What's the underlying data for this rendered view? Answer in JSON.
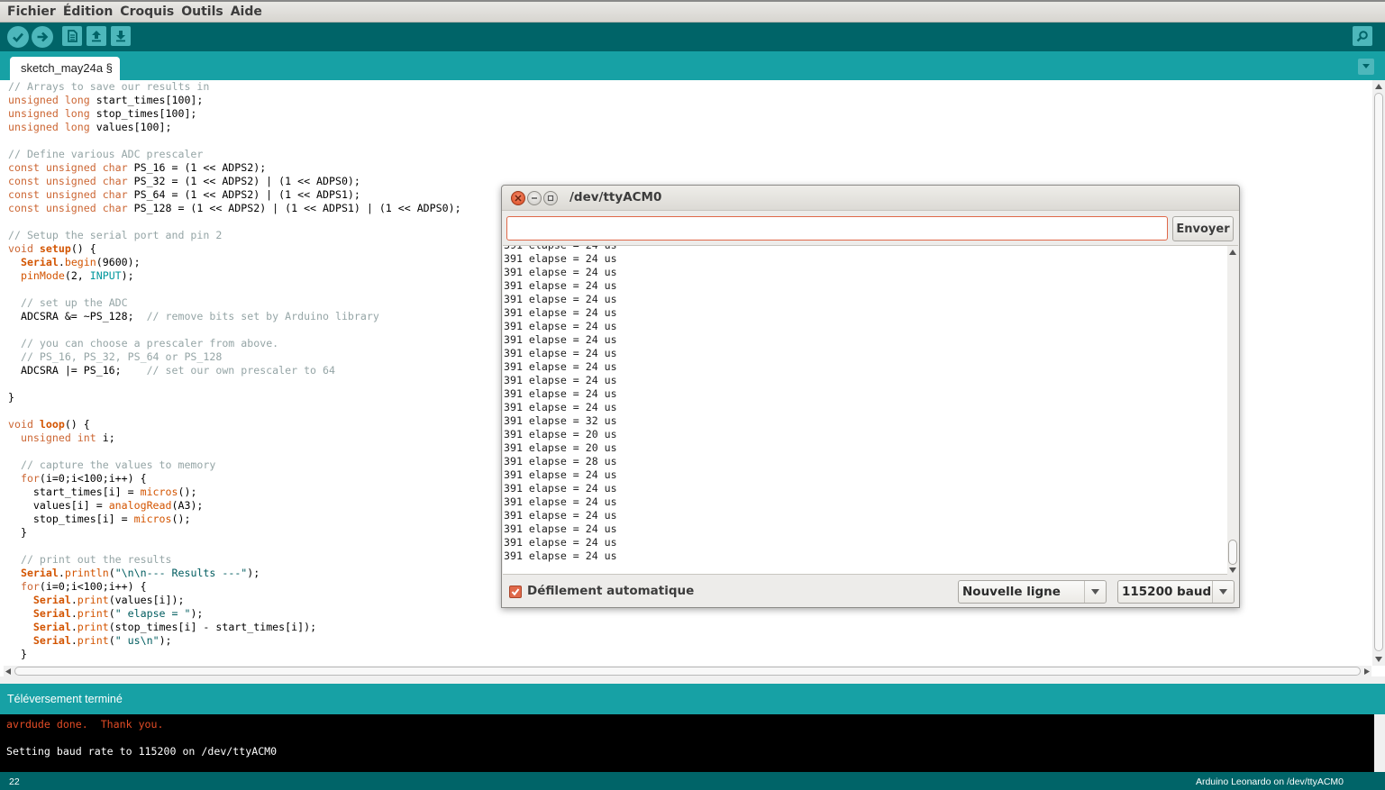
{
  "menubar": {
    "items": [
      "Fichier",
      "Édition",
      "Croquis",
      "Outils",
      "Aide"
    ]
  },
  "toolbar": {
    "buttons": [
      "verify-icon",
      "upload-icon",
      "new-icon",
      "open-icon",
      "save-icon"
    ],
    "serial_monitor_icon": "magnifier-icon"
  },
  "tabs": {
    "active": "sketch_may24a §"
  },
  "editor": {
    "lines": [
      [
        [
          "c",
          "// Arrays to save our results in"
        ]
      ],
      [
        [
          "k",
          "unsigned long"
        ],
        [
          "p",
          " start_times[100];"
        ]
      ],
      [
        [
          "k",
          "unsigned long"
        ],
        [
          "p",
          " stop_times[100];"
        ]
      ],
      [
        [
          "k",
          "unsigned long"
        ],
        [
          "p",
          " values[100];"
        ]
      ],
      [
        [
          "p",
          ""
        ]
      ],
      [
        [
          "c",
          "// Define various ADC prescaler"
        ]
      ],
      [
        [
          "k",
          "const unsigned char"
        ],
        [
          "p",
          " PS_16 = (1 << ADPS2);"
        ]
      ],
      [
        [
          "k",
          "const unsigned char"
        ],
        [
          "p",
          " PS_32 = (1 << ADPS2) | (1 << ADPS0);"
        ]
      ],
      [
        [
          "k",
          "const unsigned char"
        ],
        [
          "p",
          " PS_64 = (1 << ADPS2) | (1 << ADPS1);"
        ]
      ],
      [
        [
          "k",
          "const unsigned char"
        ],
        [
          "p",
          " PS_128 = (1 << ADPS2) | (1 << ADPS1) | (1 << ADPS0);"
        ]
      ],
      [
        [
          "p",
          ""
        ]
      ],
      [
        [
          "c",
          "// Setup the serial port and pin 2"
        ]
      ],
      [
        [
          "k",
          "void"
        ],
        [
          "p",
          " "
        ],
        [
          "fb",
          "setup"
        ],
        [
          "p",
          "() {"
        ]
      ],
      [
        [
          "p",
          "  "
        ],
        [
          "fb",
          "Serial"
        ],
        [
          "p",
          "."
        ],
        [
          "f",
          "begin"
        ],
        [
          "p",
          "(9600);"
        ]
      ],
      [
        [
          "p",
          "  "
        ],
        [
          "f",
          "pinMode"
        ],
        [
          "p",
          "(2, "
        ],
        [
          "n",
          "INPUT"
        ],
        [
          "p",
          ");"
        ]
      ],
      [
        [
          "p",
          ""
        ]
      ],
      [
        [
          "p",
          "  "
        ],
        [
          "c",
          "// set up the ADC"
        ]
      ],
      [
        [
          "p",
          "  ADCSRA &= ~PS_128;  "
        ],
        [
          "c",
          "// remove bits set by Arduino library"
        ]
      ],
      [
        [
          "p",
          ""
        ]
      ],
      [
        [
          "p",
          "  "
        ],
        [
          "c",
          "// you can choose a prescaler from above."
        ]
      ],
      [
        [
          "p",
          "  "
        ],
        [
          "c",
          "// PS_16, PS_32, PS_64 or PS_128"
        ]
      ],
      [
        [
          "p",
          "  ADCSRA |= PS_16;    "
        ],
        [
          "c",
          "// set our own prescaler to 64"
        ]
      ],
      [
        [
          "p",
          ""
        ]
      ],
      [
        [
          "p",
          "}"
        ]
      ],
      [
        [
          "p",
          ""
        ]
      ],
      [
        [
          "k",
          "void"
        ],
        [
          "p",
          " "
        ],
        [
          "fb",
          "loop"
        ],
        [
          "p",
          "() {"
        ]
      ],
      [
        [
          "p",
          "  "
        ],
        [
          "k",
          "unsigned int"
        ],
        [
          "p",
          " i;"
        ]
      ],
      [
        [
          "p",
          ""
        ]
      ],
      [
        [
          "p",
          "  "
        ],
        [
          "c",
          "// capture the values to memory"
        ]
      ],
      [
        [
          "p",
          "  "
        ],
        [
          "k",
          "for"
        ],
        [
          "p",
          "(i=0;i<100;i++) {"
        ]
      ],
      [
        [
          "p",
          "    start_times[i] = "
        ],
        [
          "f",
          "micros"
        ],
        [
          "p",
          "();"
        ]
      ],
      [
        [
          "p",
          "    values[i] = "
        ],
        [
          "f",
          "analogRead"
        ],
        [
          "p",
          "(A3);"
        ]
      ],
      [
        [
          "p",
          "    stop_times[i] = "
        ],
        [
          "f",
          "micros"
        ],
        [
          "p",
          "();"
        ]
      ],
      [
        [
          "p",
          "  }"
        ]
      ],
      [
        [
          "p",
          ""
        ]
      ],
      [
        [
          "p",
          "  "
        ],
        [
          "c",
          "// print out the results"
        ]
      ],
      [
        [
          "p",
          "  "
        ],
        [
          "fb",
          "Serial"
        ],
        [
          "p",
          "."
        ],
        [
          "f",
          "println"
        ],
        [
          "p",
          "("
        ],
        [
          "s",
          "\"\\n\\n--- Results ---\""
        ],
        [
          "p",
          ");"
        ]
      ],
      [
        [
          "p",
          "  "
        ],
        [
          "k",
          "for"
        ],
        [
          "p",
          "(i=0;i<100;i++) {"
        ]
      ],
      [
        [
          "p",
          "    "
        ],
        [
          "fb",
          "Serial"
        ],
        [
          "p",
          "."
        ],
        [
          "f",
          "print"
        ],
        [
          "p",
          "(values[i]);"
        ]
      ],
      [
        [
          "p",
          "    "
        ],
        [
          "fb",
          "Serial"
        ],
        [
          "p",
          "."
        ],
        [
          "f",
          "print"
        ],
        [
          "p",
          "("
        ],
        [
          "s",
          "\" elapse = \""
        ],
        [
          "p",
          ");"
        ]
      ],
      [
        [
          "p",
          "    "
        ],
        [
          "fb",
          "Serial"
        ],
        [
          "p",
          "."
        ],
        [
          "f",
          "print"
        ],
        [
          "p",
          "(stop_times[i] - start_times[i]);"
        ]
      ],
      [
        [
          "p",
          "    "
        ],
        [
          "fb",
          "Serial"
        ],
        [
          "p",
          "."
        ],
        [
          "f",
          "print"
        ],
        [
          "p",
          "("
        ],
        [
          "s",
          "\" us\\n\""
        ],
        [
          "p",
          ");"
        ]
      ],
      [
        [
          "p",
          "  }"
        ]
      ]
    ]
  },
  "status": {
    "message": "Téléversement terminé"
  },
  "console": {
    "lines": [
      "avrdude done.  Thank you.",
      "",
      "Setting baud rate to 115200 on /dev/ttyACM0"
    ]
  },
  "footer": {
    "line_number": "22",
    "board": "Arduino Leonardo on /dev/ttyACM0"
  },
  "serial_monitor": {
    "title": "/dev/ttyACM0",
    "input_value": "",
    "send_label": "Envoyer",
    "output_lines": [
      "391 elapse = 24 us",
      "391 elapse = 24 us",
      "391 elapse = 24 us",
      "391 elapse = 24 us",
      "391 elapse = 24 us",
      "391 elapse = 24 us",
      "391 elapse = 24 us",
      "391 elapse = 24 us",
      "391 elapse = 24 us",
      "391 elapse = 24 us",
      "391 elapse = 24 us",
      "391 elapse = 24 us",
      "391 elapse = 24 us",
      "391 elapse = 32 us",
      "391 elapse = 20 us",
      "391 elapse = 20 us",
      "391 elapse = 28 us",
      "391 elapse = 24 us",
      "391 elapse = 24 us",
      "391 elapse = 24 us",
      "391 elapse = 24 us",
      "391 elapse = 24 us",
      "391 elapse = 24 us",
      "391 elapse = 24 us"
    ],
    "autoscroll_label": "Défilement automatique",
    "autoscroll_checked": true,
    "line_ending": "Nouvelle ligne",
    "baud": "115200 baud"
  },
  "colors": {
    "teal_dark": "#006468",
    "teal": "#17a1a5",
    "teal_light": "#4db7bb",
    "keyword": "#cc6633",
    "function": "#d35400",
    "constant": "#00979c",
    "comment": "#95a5a6",
    "console_error": "#e34c26",
    "accent": "#e0694a"
  }
}
